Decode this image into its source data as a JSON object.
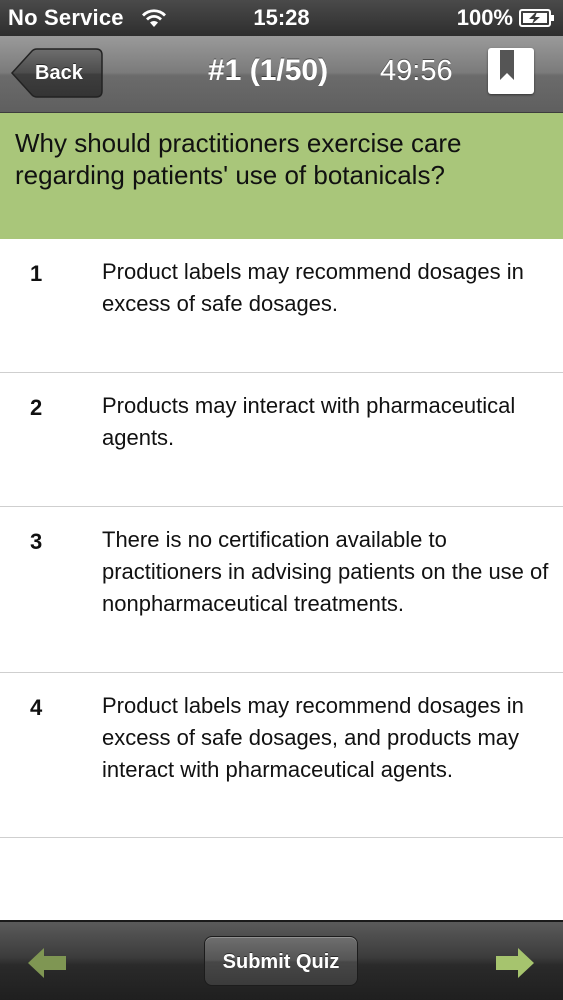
{
  "status_bar": {
    "carrier": "No Service",
    "time": "15:28",
    "battery": "100%"
  },
  "nav": {
    "back_label": "Back",
    "title": "#1 (1/50)",
    "timer": "49:56"
  },
  "question": {
    "text": "Why should practitioners exercise care regarding patients' use of botanicals?"
  },
  "answers": [
    {
      "number": "1",
      "text": "Product labels may recommend dosages in excess of safe dosages."
    },
    {
      "number": "2",
      "text": "Products may interact with pharmaceutical agents."
    },
    {
      "number": "3",
      "text": "There is no certification available to practitioners in advising patients on the use of nonpharmaceutical treatments."
    },
    {
      "number": "4",
      "text": "Product labels may recommend dosages in excess of safe dosages, and products may interact with pharmaceutical agents."
    }
  ],
  "toolbar": {
    "submit_label": "Submit Quiz"
  },
  "colors": {
    "question_bg": "#a9c67a",
    "arrow_green": "#a6c46e",
    "arrow_green_dim": "#7f9653"
  },
  "icons": {
    "wifi": "wifi-icon",
    "battery": "battery-charging-icon",
    "bookmark": "bookmark-icon",
    "prev": "arrow-left-icon",
    "next": "arrow-right-icon"
  }
}
